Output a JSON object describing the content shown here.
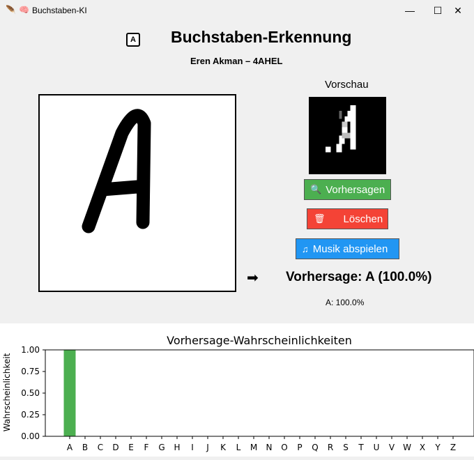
{
  "window": {
    "title": "Buchstaben-KI",
    "minimize": "—",
    "maximize": "☐",
    "close": "✕"
  },
  "header": {
    "icon_letter": "A",
    "title": "Buchstaben-Erkennung",
    "author": "Eren Akman – 4AHEL"
  },
  "canvas": {
    "drawn_letter": "A"
  },
  "preview": {
    "label": "Vorschau"
  },
  "buttons": {
    "predict": {
      "icon": "🔍",
      "label": "Vorhersagen"
    },
    "clear": {
      "icon": "🗑",
      "label": "Löschen"
    },
    "music": {
      "icon": "♫",
      "label": "Musik abspielen"
    }
  },
  "result": {
    "arrow": "➡",
    "prediction": "Vorhersage: A (100.0%)",
    "top_prob": "A: 100.0%"
  },
  "colors": {
    "bar": "#4caf50",
    "predict_btn": "#4caf50",
    "clear_btn": "#f44336",
    "music_btn": "#2196f3"
  },
  "chart_data": {
    "type": "bar",
    "title": "Vorhersage-Wahrscheinlichkeiten",
    "xlabel": "",
    "ylabel": "Wahrscheinlichkeit",
    "ylim": [
      0,
      1
    ],
    "yticks": [
      "0.00",
      "0.25",
      "0.50",
      "0.75",
      "1.00"
    ],
    "categories": [
      "A",
      "B",
      "C",
      "D",
      "E",
      "F",
      "G",
      "H",
      "I",
      "J",
      "K",
      "L",
      "M",
      "N",
      "O",
      "P",
      "Q",
      "R",
      "S",
      "T",
      "U",
      "V",
      "W",
      "X",
      "Y",
      "Z"
    ],
    "values": [
      1.0,
      0,
      0,
      0,
      0,
      0,
      0,
      0,
      0,
      0,
      0,
      0,
      0,
      0,
      0,
      0,
      0,
      0,
      0,
      0,
      0,
      0,
      0,
      0,
      0,
      0
    ]
  }
}
